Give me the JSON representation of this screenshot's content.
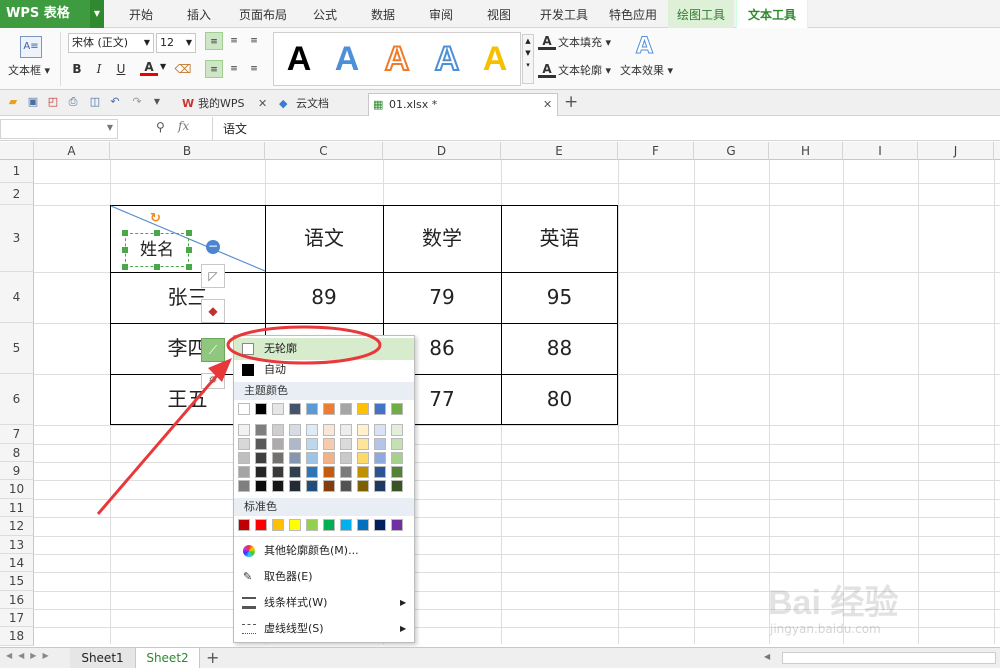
{
  "app": {
    "name": "WPS 表格"
  },
  "ribbon_tabs": [
    "开始",
    "插入",
    "页面布局",
    "公式",
    "数据",
    "审阅",
    "视图",
    "开发工具",
    "特色应用",
    "绘图工具",
    "文本工具"
  ],
  "ribbon": {
    "textbox_label": "文本框",
    "font_name": "宋体 (正文)",
    "font_size": "12",
    "bold": "B",
    "italic": "I",
    "underline": "U",
    "font_color": "A",
    "text_fill": "文本填充",
    "text_outline": "文本轮廓",
    "text_effect": "文本效果",
    "art_letter": "A"
  },
  "doc_tabs": [
    {
      "label": "我的WPS"
    },
    {
      "label": "云文档"
    },
    {
      "label": "01.xlsx *"
    }
  ],
  "formula_bar": {
    "fx": "fx",
    "content": "语文"
  },
  "columns": [
    "A",
    "B",
    "C",
    "D",
    "E",
    "F",
    "G",
    "H",
    "I",
    "J"
  ],
  "rows": [
    "1",
    "2",
    "3",
    "4",
    "5",
    "6",
    "7",
    "8",
    "9",
    "10",
    "11",
    "12",
    "13",
    "14",
    "15",
    "16",
    "17",
    "18"
  ],
  "table": {
    "header": [
      "姓名",
      "语文",
      "数学",
      "英语"
    ],
    "rows": [
      [
        "张三",
        "89",
        "79",
        "95"
      ],
      [
        "李四",
        "",
        "86",
        "88"
      ],
      [
        "王五",
        "",
        "77",
        "80"
      ]
    ]
  },
  "menu": {
    "no_outline": "无轮廓",
    "auto": "自动",
    "theme_colors": "主题颜色",
    "standard_colors": "标准色",
    "more_colors": "其他轮廓颜色(M)...",
    "eyedropper": "取色器(E)",
    "line_style": "线条样式(W)",
    "dash_style": "虚线线型(S)"
  },
  "theme_row": [
    "#ffffff",
    "#000000",
    "#e7e6e6",
    "#44546a",
    "#5b9bd5",
    "#ed7d31",
    "#a5a5a5",
    "#ffc000",
    "#4472c4",
    "#70ad47"
  ],
  "theme_shades": [
    [
      "#f2f2f2",
      "#7f7f7f",
      "#d0cece",
      "#d6dce4",
      "#deebf6",
      "#fbe5d5",
      "#ededed",
      "#fff2cc",
      "#dae3f3",
      "#e2efd9"
    ],
    [
      "#d8d8d8",
      "#595959",
      "#aeabab",
      "#adb9ca",
      "#bdd7ee",
      "#f7cbac",
      "#dbdbdb",
      "#fee599",
      "#b4c6e7",
      "#c5e0b3"
    ],
    [
      "#bfbfbf",
      "#3f3f3f",
      "#757070",
      "#8496b0",
      "#9dc3e6",
      "#f4b183",
      "#c9c9c9",
      "#ffd965",
      "#8faadc",
      "#a8d08d"
    ],
    [
      "#a5a5a5",
      "#262626",
      "#3a3838",
      "#323f4f",
      "#2e75b5",
      "#c55a11",
      "#7b7b7b",
      "#bf9000",
      "#2f5496",
      "#538135"
    ],
    [
      "#7f7f7f",
      "#0c0c0c",
      "#171616",
      "#222a35",
      "#1e4e79",
      "#833c0b",
      "#525252",
      "#7f6000",
      "#1f3864",
      "#375623"
    ]
  ],
  "standard_row": [
    "#c00000",
    "#ff0000",
    "#ffc000",
    "#ffff00",
    "#92d050",
    "#00b050",
    "#00b0f0",
    "#0070c0",
    "#002060",
    "#7030a0"
  ],
  "sheets": [
    "Sheet1",
    "Sheet2"
  ],
  "watermark": {
    "text": "Bai 经验",
    "url": "jingyan.baidu.com"
  }
}
